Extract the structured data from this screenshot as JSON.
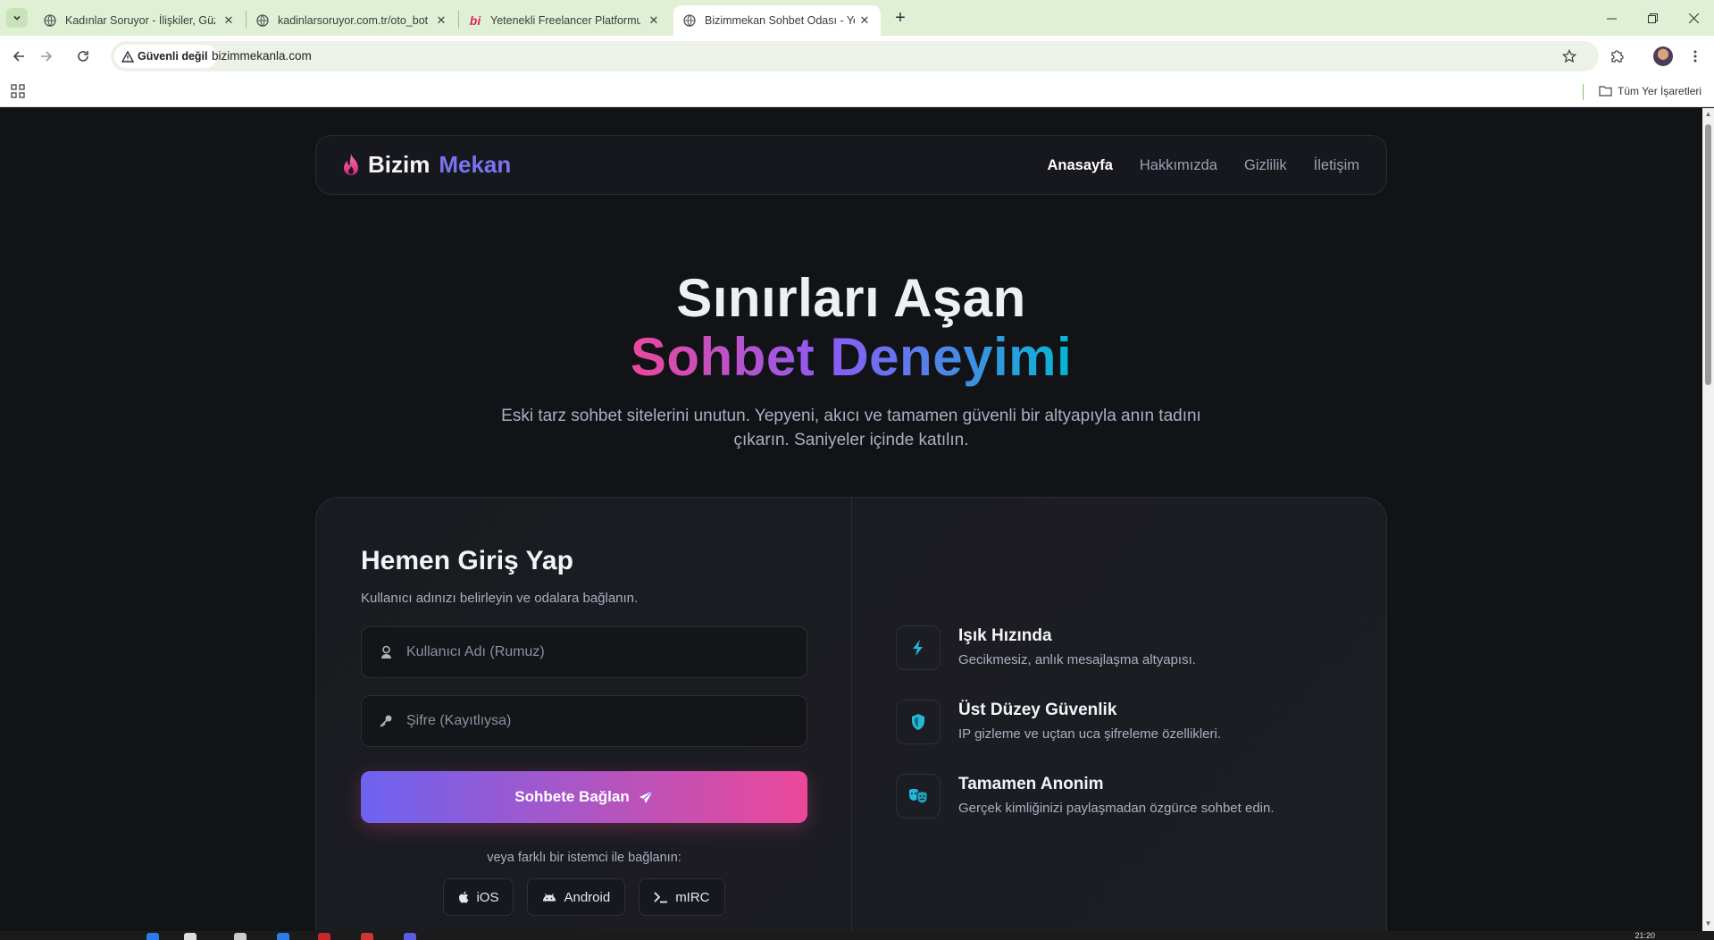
{
  "browser": {
    "tabs": [
      {
        "title": "Kadınlar Soruyor - İlişkiler, Güzellik",
        "favicon": "globe-icon",
        "active": false
      },
      {
        "title": "kadinlarsoruyor.com.tr/oto_bot",
        "favicon": "globe-icon",
        "active": false
      },
      {
        "title": "Yetenekli Freelancer Platformu",
        "favicon": "bionluk-logo",
        "active": false
      },
      {
        "title": "Bizimmekan Sohbet Odası - Yeni",
        "favicon": "globe-icon",
        "active": true
      }
    ],
    "security_label": "Güvenli değil",
    "url": "bizimmekanla.com",
    "bookmarks_all": "Tüm Yer İşaretleri"
  },
  "site": {
    "logo_word1": "Bizim",
    "logo_word2": "Mekan",
    "nav": [
      "Anasayfa",
      "Hakkımızda",
      "Gizlilik",
      "İletişim"
    ],
    "hero_line1": "Sınırları Aşan",
    "hero_line2": "Sohbet Deneyimi",
    "hero_sub": "Eski tarz sohbet sitelerini unutun. Yepyeni, akıcı ve tamamen güvenli bir altyapıyla anın tadını çıkarın. Saniyeler içinde katılın.",
    "login": {
      "title": "Hemen Giriş Yap",
      "subtitle": "Kullanıcı adınızı belirleyin ve odalara bağlanın.",
      "username_placeholder": "Kullanıcı Adı (Rumuz)",
      "password_placeholder": "Şifre (Kayıtlıysa)",
      "submit_label": "Sohbete Bağlan",
      "alt_text": "veya farklı bir istemci ile bağlanın:",
      "clients": [
        "iOS",
        "Android",
        "mIRC"
      ]
    },
    "features": [
      {
        "title": "Işık Hızında",
        "desc": "Gecikmesiz, anlık mesajlaşma altyapısı.",
        "icon": "bolt-icon"
      },
      {
        "title": "Üst Düzey Güvenlik",
        "desc": "IP gizleme ve uçtan uca şifreleme özellikleri.",
        "icon": "shield-icon"
      },
      {
        "title": "Tamamen Anonim",
        "desc": "Gerçek kimliğinizi paylaşmadan özgürce sohbet edin.",
        "icon": "masks-icon"
      }
    ]
  },
  "taskbar": {
    "clock": "21:20"
  },
  "colors": {
    "accent_purple": "#7c73f0",
    "accent_pink": "#ec4899",
    "accent_cyan": "#06b6d4",
    "page_bg": "#121317"
  }
}
